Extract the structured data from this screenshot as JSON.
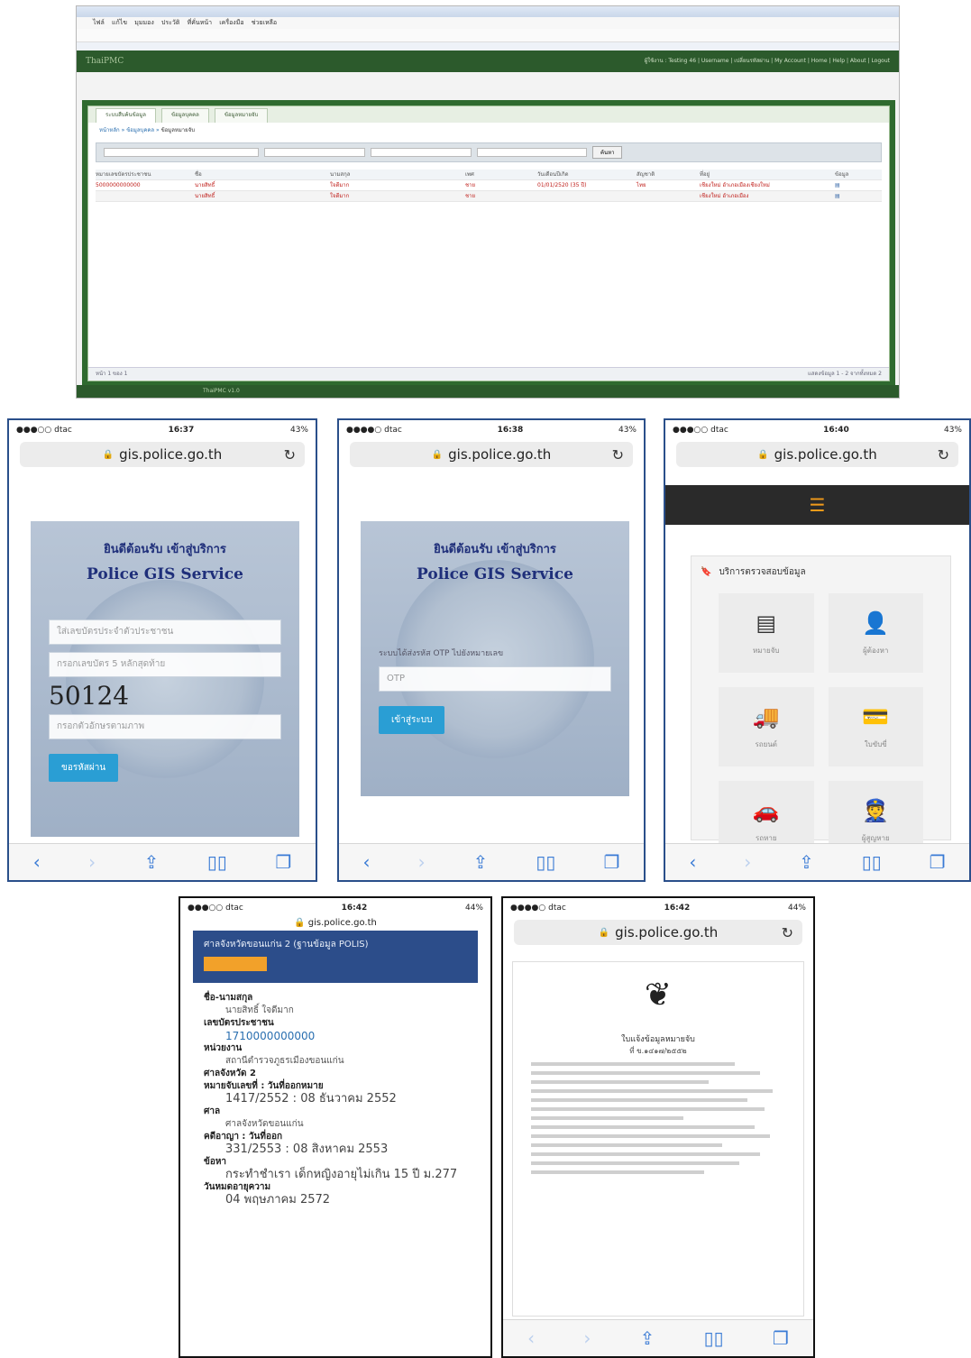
{
  "desktop": {
    "menu": "ไฟล์ แก้ไข มุมมอง ประวัติ ที่คั่นหน้า เครื่องมือ ช่วยเหลือ",
    "app_title": "ThaiPMC",
    "top_links": "ผู้ใช้งาน : Testing 46 | Username | เปลี่ยนรหัสผ่าน | My Account | Home | Help | About | Logout",
    "tabs": [
      "ระบบสืบค้นข้อมูล",
      "ข้อมูลบุคคล",
      "ข้อมูลหมายจับ"
    ],
    "breadcrumb": [
      "หน้าหลัก",
      "ข้อมูลบุคคล",
      "ข้อมูลหมายจับ"
    ],
    "search_button": "ค้นหา",
    "columns": [
      "หมายเลขบัตรประชาชน",
      "ชื่อ",
      "นามสกุล",
      "เพศ",
      "วันเดือนปีเกิด",
      "สัญชาติ",
      "ที่อยู่",
      "ข้อมูล"
    ],
    "rows": [
      [
        "5000000000000",
        "นายสิทธิ์",
        "ใจดีมาก",
        "ชาย",
        "01/01/2520 (35 ปี)",
        "ไทย",
        "เชียงใหม่ อำเภอเมืองเชียงใหม่",
        ""
      ],
      [
        "",
        "นายสิทธิ์",
        "ใจดีมาก",
        "ชาย",
        "",
        "",
        "เชียงใหม่ อำเภอเมือง",
        ""
      ]
    ],
    "footer_left": "หน้า 1 ของ 1",
    "footer_right": "แสดงข้อมูล 1 - 2 จากทั้งหมด 2",
    "status": "ThaiPMC v1.0"
  },
  "phones": [
    {
      "carrier": "●●●○○ dtac",
      "time": "16:37",
      "battery": "43%",
      "url": "gis.police.go.th",
      "welcome_th": "ยินดีต้อนรับ เข้าสู่บริการ",
      "welcome_en": "Police GIS Service",
      "username_placeholder": "ใส่เลขบัตรประจำตัวประชาชน",
      "password_placeholder": "กรอกเลขบัตร 5 หลักสุดท้าย",
      "captcha": "50124",
      "captcha_placeholder": "กรอกตัวอักษรตามภาพ",
      "button": "ขอรหัสผ่าน"
    },
    {
      "carrier": "●●●●○ dtac",
      "time": "16:38",
      "battery": "43%",
      "url": "gis.police.go.th",
      "welcome_th": "ยินดีต้อนรับ เข้าสู่บริการ",
      "welcome_en": "Police GIS Service",
      "otp_note": "ระบบได้ส่งรหัส OTP ไปยังหมายเลข",
      "otp_placeholder": "OTP",
      "button": "เข้าสู่ระบบ"
    },
    {
      "carrier": "●●●○○ dtac",
      "time": "16:40",
      "battery": "43%",
      "url": "gis.police.go.th",
      "section": "บริการตรวจสอบข้อมูล",
      "tiles": [
        "หมายจับ",
        "ผู้ต้องหา",
        "รถยนต์",
        "ใบขับขี่",
        "รถหาย",
        "ผู้สูญหาย"
      ]
    },
    {
      "carrier": "●●●○○ dtac",
      "time": "16:42",
      "battery": "44%",
      "url": "gis.police.go.th",
      "header": "ศาลจังหวัดขอนแก่น 2 (ฐานข้อมูล POLIS)",
      "fields": [
        {
          "label": "ชื่อ-นามสกุล",
          "value": "นายสิทธิ์ ใจดีมาก"
        },
        {
          "label": "เลขบัตรประชาชน",
          "value": "1710000000000"
        },
        {
          "label": "หน่วยงาน",
          "value": "สถานีตำรวจภูธรเมืองขอนแก่น"
        },
        {
          "label": "ศาลจังหวัด 2",
          "value": ""
        },
        {
          "label": "หมายจับเลขที่ : วันที่ออกหมาย",
          "value": "1417/2552 : 08 ธันวาคม 2552"
        },
        {
          "label": "ศาล",
          "value": "ศาลจังหวัดขอนแก่น"
        },
        {
          "label": "คดีอาญา : วันที่ออก",
          "value": "331/2553 : 08 สิงหาคม 2553"
        },
        {
          "label": "ข้อหา",
          "value": "กระทำชำเรา เด็กหญิงอายุไม่เกิน 15 ปี ม.277"
        },
        {
          "label": "วันหมดอายุความ",
          "value": "04 พฤษภาคม 2572"
        }
      ]
    },
    {
      "carrier": "●●●●○ dtac",
      "time": "16:42",
      "battery": "44%",
      "url": "gis.police.go.th",
      "doc_title": "ใบแจ้งข้อมูลหมายจับ",
      "doc_number": "ที่ ข.๑๔๑๗/๒๕๕๒"
    }
  ]
}
